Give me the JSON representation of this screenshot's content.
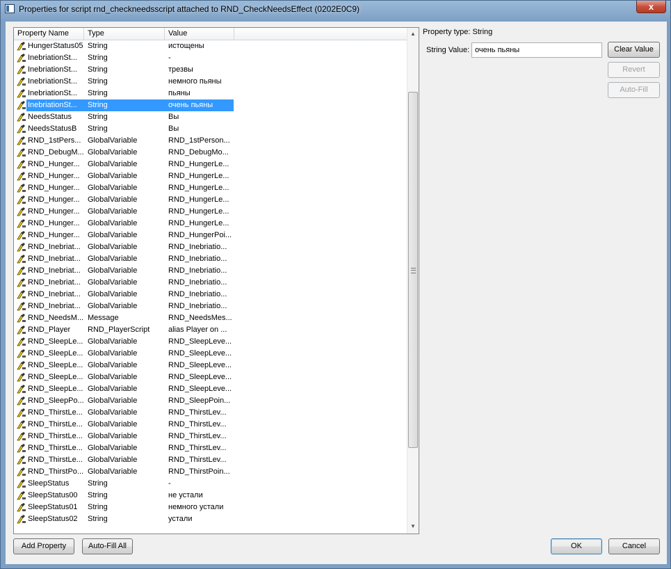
{
  "window": {
    "title": "Properties for script rnd_checkneedsscript attached to RND_CheckNeedsEffect (0202E0C9)",
    "close_glyph": "x"
  },
  "list": {
    "columns": [
      "Property Name",
      "Type",
      "Value"
    ],
    "selected_index": 5,
    "rows": [
      {
        "name": "HungerStatus05",
        "type": "String",
        "value": "истощены"
      },
      {
        "name": "InebriationSt...",
        "type": "String",
        "value": "-"
      },
      {
        "name": "InebriationSt...",
        "type": "String",
        "value": "трезвы"
      },
      {
        "name": "InebriationSt...",
        "type": "String",
        "value": "немного пьяны"
      },
      {
        "name": "InebriationSt...",
        "type": "String",
        "value": "пьяны"
      },
      {
        "name": "InebriationSt...",
        "type": "String",
        "value": "очень пьяны"
      },
      {
        "name": "NeedsStatus",
        "type": "String",
        "value": "Вы"
      },
      {
        "name": "NeedsStatusB",
        "type": "String",
        "value": "Вы"
      },
      {
        "name": "RND_1stPers...",
        "type": "GlobalVariable",
        "value": "RND_1stPerson..."
      },
      {
        "name": "RND_DebugM...",
        "type": "GlobalVariable",
        "value": "RND_DebugMo..."
      },
      {
        "name": "RND_Hunger...",
        "type": "GlobalVariable",
        "value": "RND_HungerLe..."
      },
      {
        "name": "RND_Hunger...",
        "type": "GlobalVariable",
        "value": "RND_HungerLe..."
      },
      {
        "name": "RND_Hunger...",
        "type": "GlobalVariable",
        "value": "RND_HungerLe..."
      },
      {
        "name": "RND_Hunger...",
        "type": "GlobalVariable",
        "value": "RND_HungerLe..."
      },
      {
        "name": "RND_Hunger...",
        "type": "GlobalVariable",
        "value": "RND_HungerLe..."
      },
      {
        "name": "RND_Hunger...",
        "type": "GlobalVariable",
        "value": "RND_HungerLe..."
      },
      {
        "name": "RND_Hunger...",
        "type": "GlobalVariable",
        "value": "RND_HungerPoi..."
      },
      {
        "name": "RND_Inebriat...",
        "type": "GlobalVariable",
        "value": "RND_Inebriatio..."
      },
      {
        "name": "RND_Inebriat...",
        "type": "GlobalVariable",
        "value": "RND_Inebriatio..."
      },
      {
        "name": "RND_Inebriat...",
        "type": "GlobalVariable",
        "value": "RND_Inebriatio..."
      },
      {
        "name": "RND_Inebriat...",
        "type": "GlobalVariable",
        "value": "RND_Inebriatio..."
      },
      {
        "name": "RND_Inebriat...",
        "type": "GlobalVariable",
        "value": "RND_Inebriatio..."
      },
      {
        "name": "RND_Inebriat...",
        "type": "GlobalVariable",
        "value": "RND_Inebriatio..."
      },
      {
        "name": "RND_NeedsM...",
        "type": "Message",
        "value": "RND_NeedsMes..."
      },
      {
        "name": "RND_Player",
        "type": "RND_PlayerScript",
        "value": "alias Player on ..."
      },
      {
        "name": "RND_SleepLe...",
        "type": "GlobalVariable",
        "value": "RND_SleepLeve..."
      },
      {
        "name": "RND_SleepLe...",
        "type": "GlobalVariable",
        "value": "RND_SleepLeve..."
      },
      {
        "name": "RND_SleepLe...",
        "type": "GlobalVariable",
        "value": "RND_SleepLeve..."
      },
      {
        "name": "RND_SleepLe...",
        "type": "GlobalVariable",
        "value": "RND_SleepLeve..."
      },
      {
        "name": "RND_SleepLe...",
        "type": "GlobalVariable",
        "value": "RND_SleepLeve..."
      },
      {
        "name": "RND_SleepPo...",
        "type": "GlobalVariable",
        "value": "RND_SleepPoin..."
      },
      {
        "name": "RND_ThirstLe...",
        "type": "GlobalVariable",
        "value": "RND_ThirstLev..."
      },
      {
        "name": "RND_ThirstLe...",
        "type": "GlobalVariable",
        "value": "RND_ThirstLev..."
      },
      {
        "name": "RND_ThirstLe...",
        "type": "GlobalVariable",
        "value": "RND_ThirstLev..."
      },
      {
        "name": "RND_ThirstLe...",
        "type": "GlobalVariable",
        "value": "RND_ThirstLev..."
      },
      {
        "name": "RND_ThirstLe...",
        "type": "GlobalVariable",
        "value": "RND_ThirstLev..."
      },
      {
        "name": "RND_ThirstPo...",
        "type": "GlobalVariable",
        "value": "RND_ThirstPoin..."
      },
      {
        "name": "SleepStatus",
        "type": "String",
        "value": "-"
      },
      {
        "name": "SleepStatus00",
        "type": "String",
        "value": "не устали"
      },
      {
        "name": "SleepStatus01",
        "type": "String",
        "value": "немного устали"
      },
      {
        "name": "SleepStatus02",
        "type": "String",
        "value": "устали"
      }
    ]
  },
  "side": {
    "property_type_label": "Property type: String",
    "string_value_label": "String Value:",
    "string_value": "очень пьяны",
    "clear_value_label": "Clear Value",
    "revert_label": "Revert",
    "auto_fill_label": "Auto-Fill"
  },
  "footer": {
    "add_property_label": "Add Property",
    "auto_fill_all_label": "Auto-Fill All",
    "ok_label": "OK",
    "cancel_label": "Cancel"
  },
  "colors": {
    "selection": "#3399ff",
    "icon_yellow": "#e8c818"
  },
  "icons": {
    "row": "script-property-icon",
    "title": "window-app-icon"
  }
}
